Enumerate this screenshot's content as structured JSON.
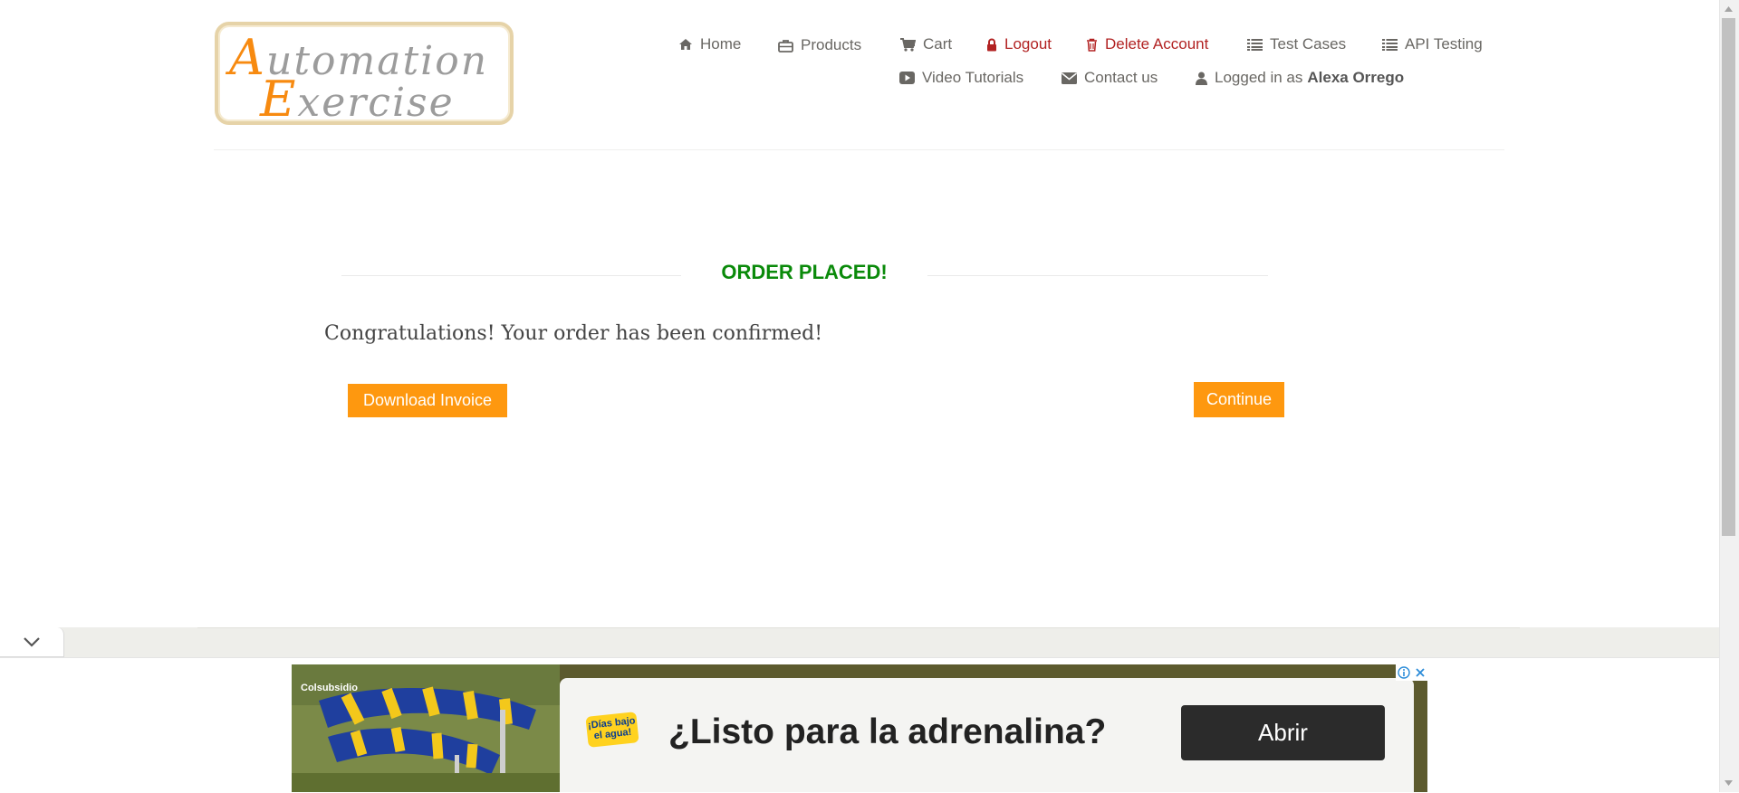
{
  "logo": {
    "line1_cap": "A",
    "line1_rest": "utomation",
    "line2_cap": "E",
    "line2_rest": "xercise"
  },
  "nav": {
    "home": "Home",
    "products": "Products",
    "cart": "Cart",
    "logout": "Logout",
    "delete_account": "Delete Account",
    "test_cases": "Test Cases",
    "api_testing": "API Testing",
    "video_tutorials": "Video Tutorials",
    "contact_us": "Contact us",
    "logged_in_prefix": "Logged in as",
    "logged_in_user": "Alexa Orrego"
  },
  "order": {
    "title": "ORDER PLACED!",
    "message": "Congratulations! Your order has been confirmed!",
    "download_invoice": "Download Invoice",
    "continue": "Continue"
  },
  "ad": {
    "brand": "Colsubsidio",
    "badge_line1": "¡Días bajo",
    "badge_line2": "el agua!",
    "headline": "¿Listo para la adrenalina?",
    "button": "Abrir"
  },
  "icons": [
    "home-icon",
    "briefcase-icon",
    "cart-icon",
    "lock-icon",
    "trash-icon",
    "list-icon",
    "youtube-icon",
    "envelope-icon",
    "user-icon",
    "chevron-down-icon",
    "adchoices-icon",
    "close-icon"
  ],
  "colors": {
    "accent": "#fe980f",
    "success": "#0a8a0a",
    "danger": "#b22222",
    "text": "#696763"
  }
}
